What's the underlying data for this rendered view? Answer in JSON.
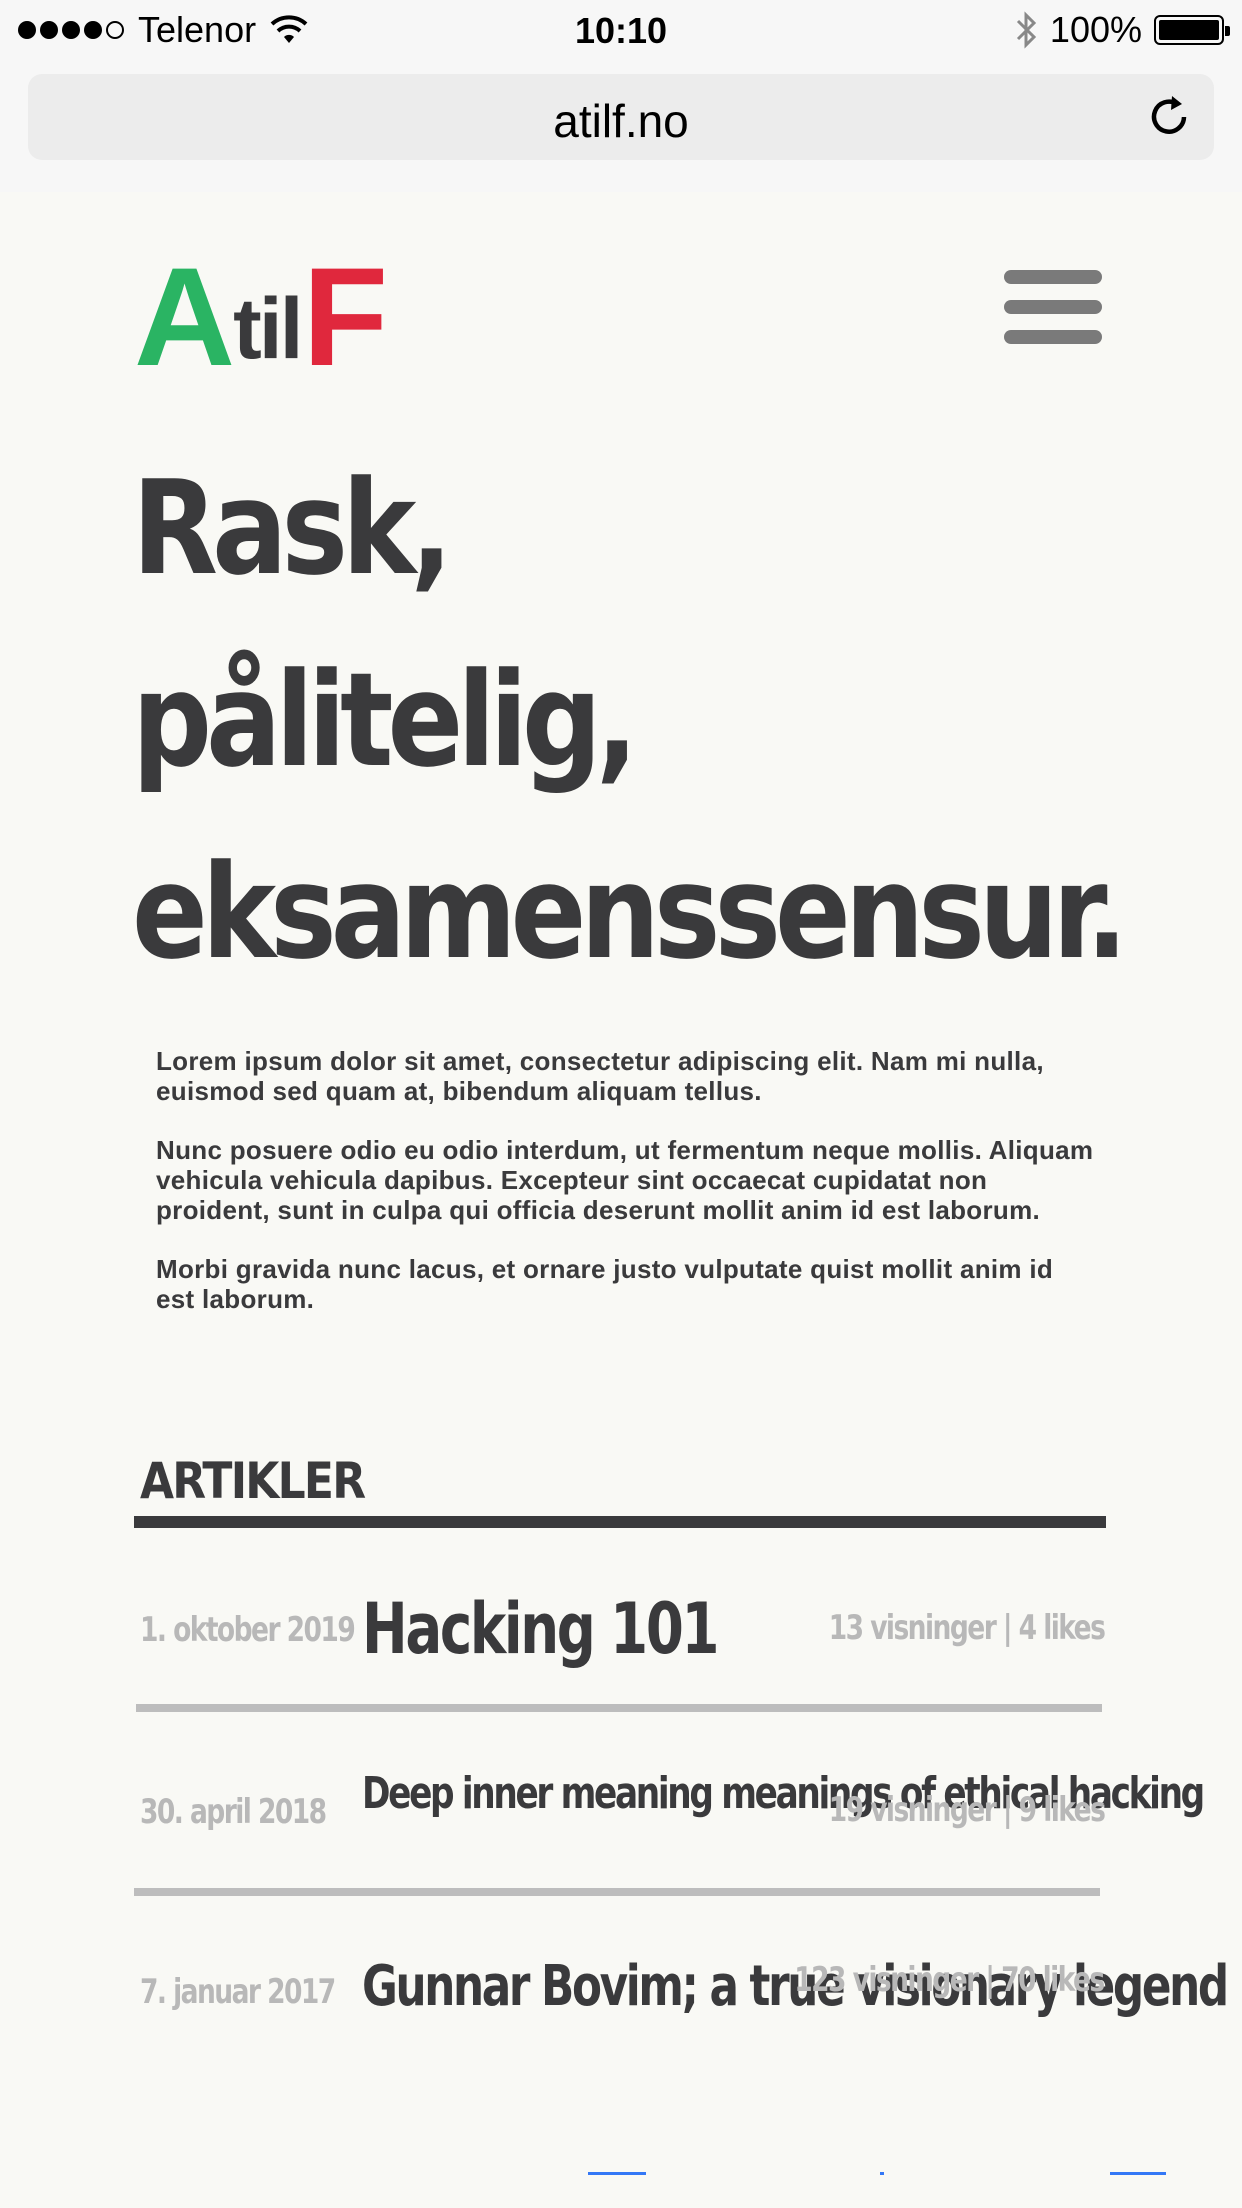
{
  "status_bar": {
    "carrier": "Telenor",
    "time": "10:10",
    "battery": "100%",
    "battery_level": 1.0
  },
  "browser": {
    "url": "atilf.no"
  },
  "logo": {
    "part1": "A",
    "part2": "til",
    "part3": "F",
    "color_a": "#2ab463",
    "color_f": "#e0283d"
  },
  "hero": {
    "line1": "Rask,",
    "line2": "pålitelig,",
    "line3": "eksamenssensur."
  },
  "intro": {
    "p1": "Lorem ipsum dolor sit amet, consectetur adipiscing elit. Nam mi nulla, euismod sed quam at, bibendum aliquam tellus.",
    "p2": "Nunc posuere odio eu odio interdum, ut fermentum neque mollis. Aliquam vehicula vehicula dapibus. Excepteur sint occaecat cupidatat non proident, sunt in culpa qui officia deserunt mollit anim id est laborum.",
    "p3": "Morbi gravida nunc lacus, et ornare justo vulputate quist mollit anim id est laborum."
  },
  "articles": {
    "heading": "ARTIKLER",
    "items": [
      {
        "date": "1. oktober 2019",
        "title": "Hacking 101",
        "stats": "13 visninger | 4 likes"
      },
      {
        "date": "30. april 2018",
        "title": "Deep inner meaning meanings of ethical hacking",
        "stats": "19 visninger | 9 likes"
      },
      {
        "date": "7. januar 2017",
        "title": "Gunnar Bovim; a true visionary legend",
        "stats": "123 visninger | 70 likes"
      }
    ]
  }
}
